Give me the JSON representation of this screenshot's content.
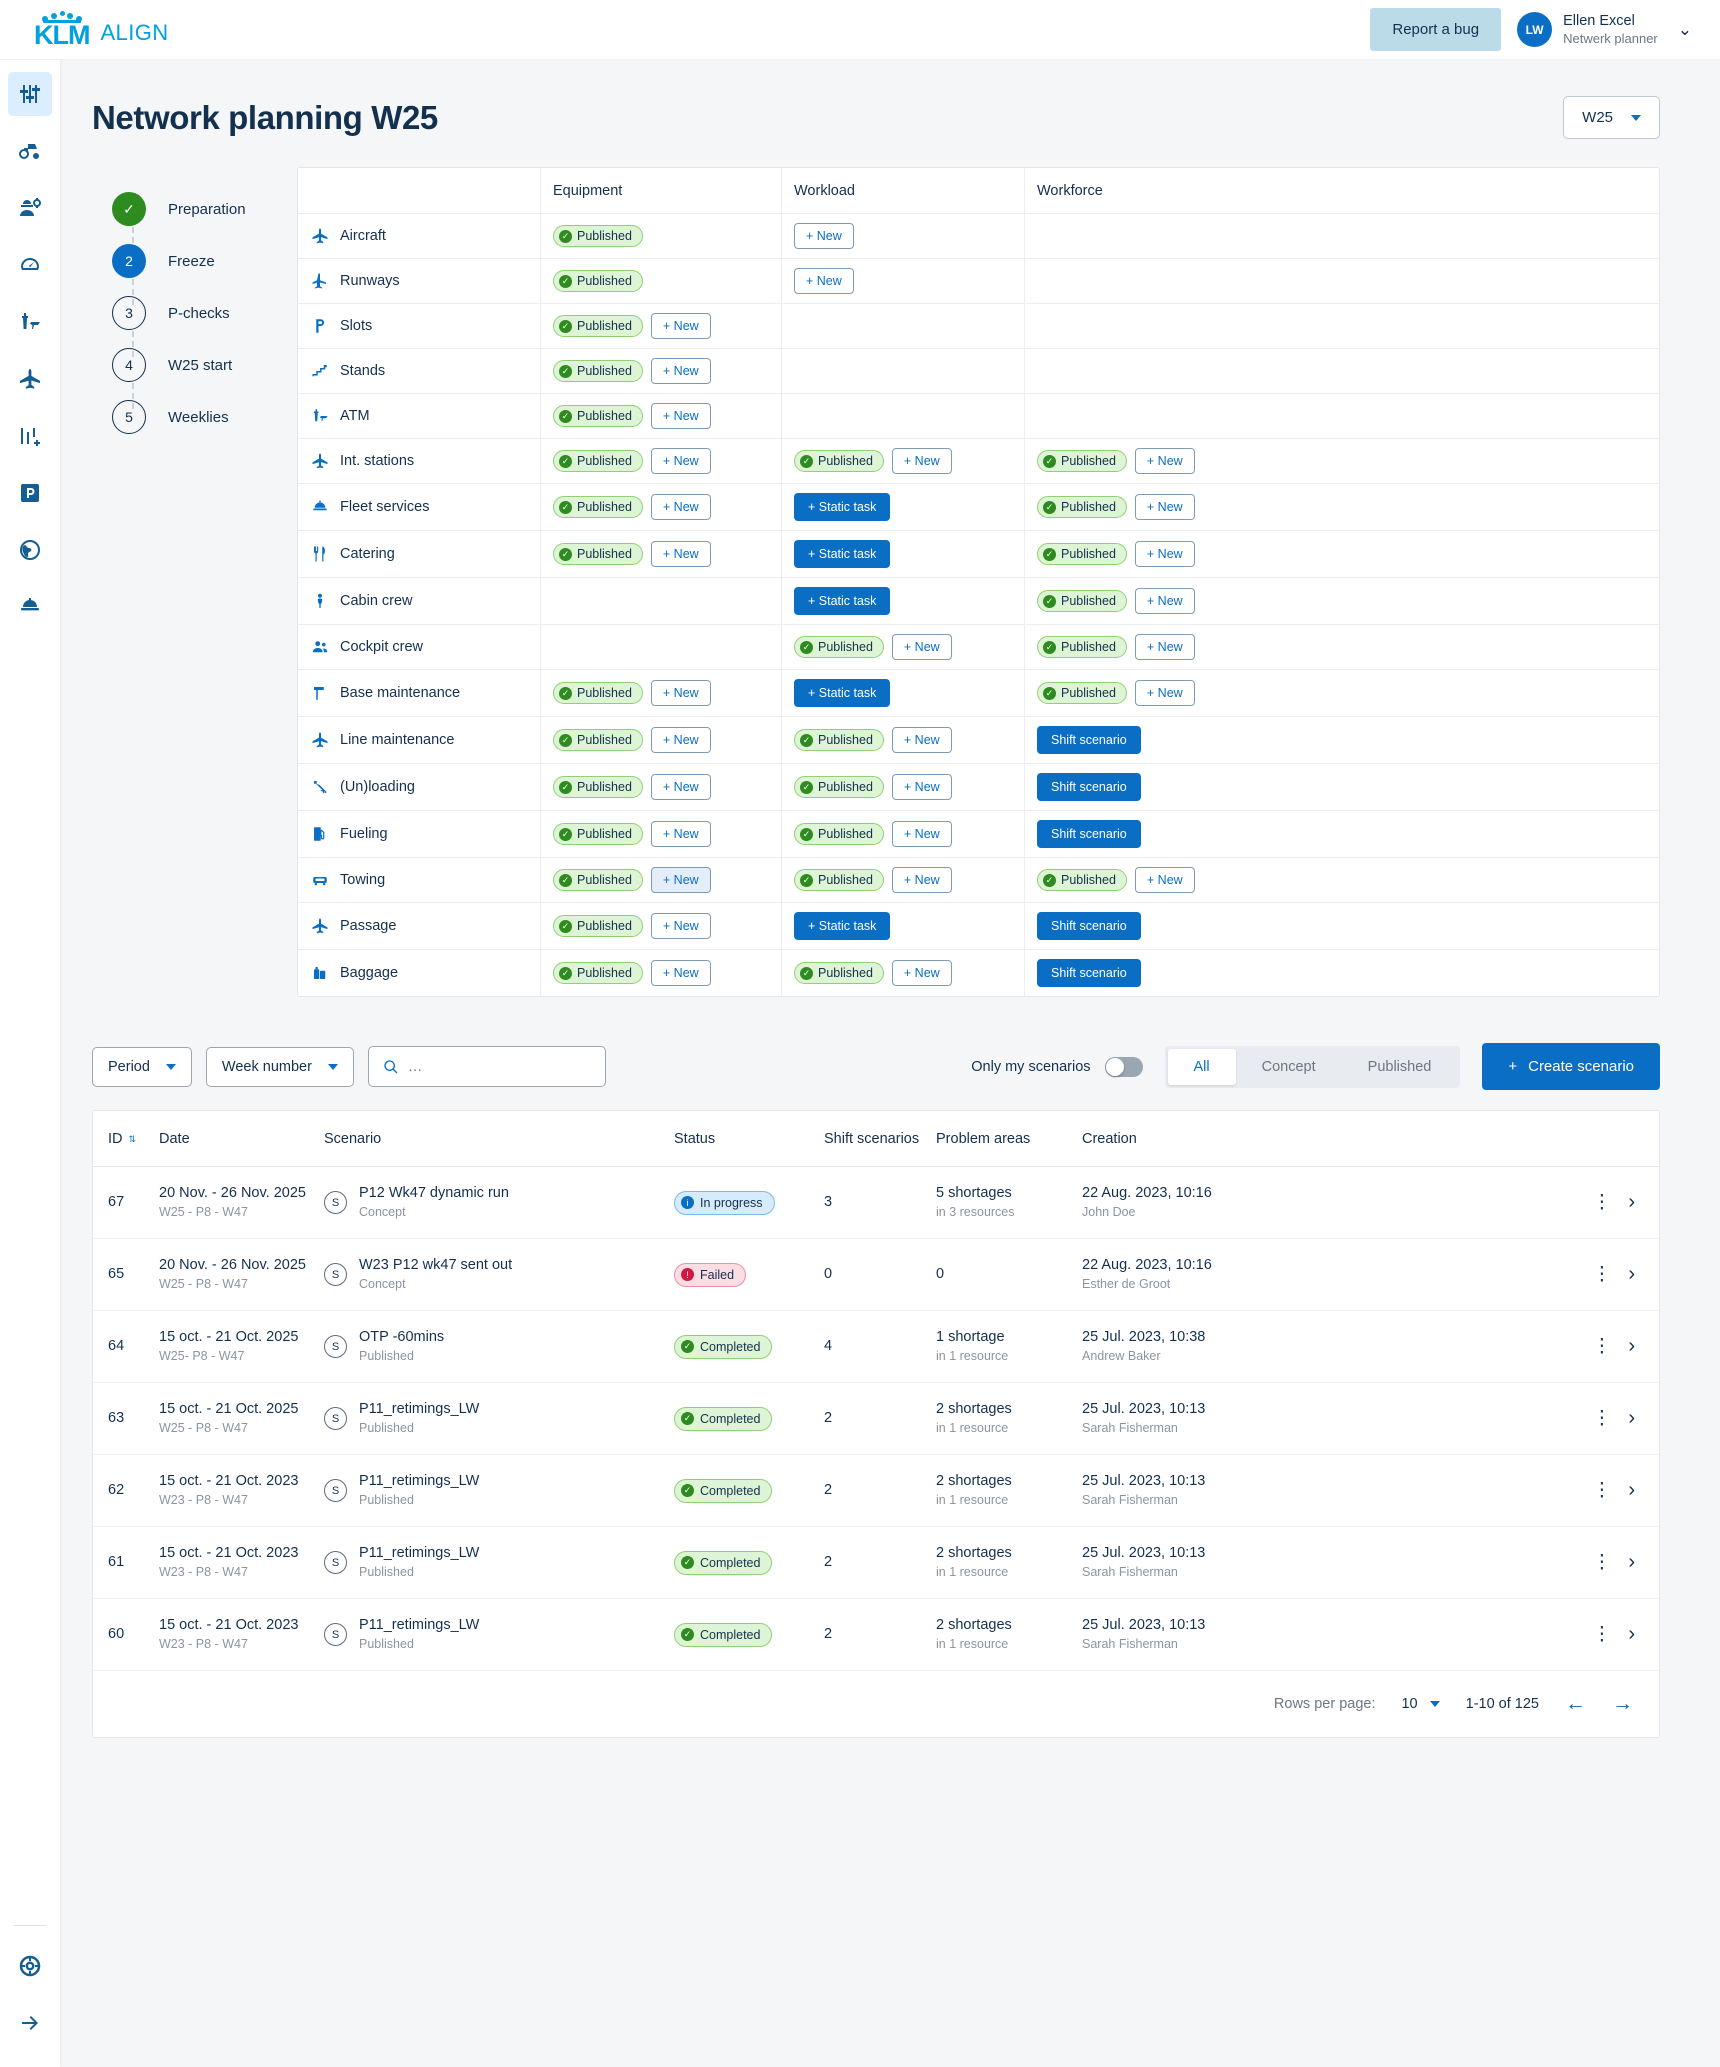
{
  "header": {
    "brand_main": "KLM",
    "brand_sub": "ALIGN",
    "report_bug": "Report a bug",
    "avatar_initials": "LW",
    "user_name": "Ellen Excel",
    "user_role": "Netwerk planner"
  },
  "sidebar": {
    "items": [
      {
        "name": "sliders-icon",
        "label": "Planning settings"
      },
      {
        "name": "tractor-icon",
        "label": "Ground equipment"
      },
      {
        "name": "engineer-icon",
        "label": "Engineering"
      },
      {
        "name": "gauge-icon",
        "label": "Performance"
      },
      {
        "name": "control-tower-icon",
        "label": "ATM"
      },
      {
        "name": "airplane-icon",
        "label": "Aircraft"
      },
      {
        "name": "chart-add-icon",
        "label": "Scenarios"
      },
      {
        "name": "parking-icon",
        "label": "Stands"
      },
      {
        "name": "globe-icon",
        "label": "Network"
      },
      {
        "name": "service-bell-icon",
        "label": "Fleet services"
      }
    ],
    "bottom": [
      {
        "name": "lifebuoy-icon",
        "label": "Help"
      },
      {
        "name": "arrow-right-icon",
        "label": "Expand menu"
      }
    ]
  },
  "page": {
    "title": "Network planning W25",
    "week_select": "W25"
  },
  "stepper": [
    {
      "marker": "✓",
      "label": "Preparation",
      "state": "done"
    },
    {
      "marker": "2",
      "label": "Freeze",
      "state": "current"
    },
    {
      "marker": "3",
      "label": "P-checks",
      "state": "todo"
    },
    {
      "marker": "4",
      "label": "W25 start",
      "state": "todo"
    },
    {
      "marker": "5",
      "label": "Weeklies",
      "state": "todo"
    }
  ],
  "status_table": {
    "columns": [
      "",
      "Equipment",
      "Workload",
      "Workforce"
    ],
    "labels": {
      "published": "Published",
      "new": "+ New",
      "static_task": "+ Static task",
      "shift_scenario": "Shift scenario"
    },
    "rows": [
      {
        "icon": "airplane-icon",
        "name": "Aircraft",
        "equipment": {
          "published": true,
          "new": false
        },
        "workload": {
          "published": false,
          "new": true
        },
        "workforce": {}
      },
      {
        "icon": "runway-icon",
        "name": "Runways",
        "equipment": {
          "published": true,
          "new": false
        },
        "workload": {
          "published": false,
          "new": true
        },
        "workforce": {}
      },
      {
        "icon": "parking-icon",
        "name": "Slots",
        "equipment": {
          "published": true,
          "new": true
        },
        "workload": {},
        "workforce": {}
      },
      {
        "icon": "stairs-icon",
        "name": "Stands",
        "equipment": {
          "published": true,
          "new": true
        },
        "workload": {},
        "workforce": {}
      },
      {
        "icon": "control-tower-icon",
        "name": "ATM",
        "equipment": {
          "published": true,
          "new": true
        },
        "workload": {},
        "workforce": {}
      },
      {
        "icon": "airplane-icon",
        "name": "Int. stations",
        "equipment": {
          "published": true,
          "new": true
        },
        "workload": {
          "published": true,
          "new": true
        },
        "workforce": {
          "published": true,
          "new": true
        }
      },
      {
        "icon": "service-bell-icon",
        "name": "Fleet services",
        "equipment": {
          "published": true,
          "new": true
        },
        "workload": {
          "static": true
        },
        "workforce": {
          "published": true,
          "new": true
        }
      },
      {
        "icon": "cutlery-icon",
        "name": "Catering",
        "equipment": {
          "published": true,
          "new": true
        },
        "workload": {
          "static": true
        },
        "workforce": {
          "published": true,
          "new": true
        }
      },
      {
        "icon": "person-icon",
        "name": "Cabin crew",
        "equipment": {},
        "workload": {
          "static": true
        },
        "workforce": {
          "published": true,
          "new": true
        }
      },
      {
        "icon": "people-icon",
        "name": "Cockpit crew",
        "equipment": {},
        "workload": {
          "published": true,
          "new": true
        },
        "workforce": {
          "published": true,
          "new": true
        }
      },
      {
        "icon": "wrench-icon",
        "name": "Base maintenance",
        "equipment": {
          "published": true,
          "new": true
        },
        "workload": {
          "static": true
        },
        "workforce": {
          "published": true,
          "new": true
        }
      },
      {
        "icon": "airplane-icon",
        "name": "Line maintenance",
        "equipment": {
          "published": true,
          "new": true
        },
        "workload": {
          "published": true,
          "new": true
        },
        "workforce": {
          "shift": true
        }
      },
      {
        "icon": "loading-icon",
        "name": "(Un)loading",
        "equipment": {
          "published": true,
          "new": true
        },
        "workload": {
          "published": true,
          "new": true
        },
        "workforce": {
          "shift": true
        }
      },
      {
        "icon": "fuel-icon",
        "name": "Fueling",
        "equipment": {
          "published": true,
          "new": true
        },
        "workload": {
          "published": true,
          "new": true
        },
        "workforce": {
          "shift": true
        }
      },
      {
        "icon": "tow-icon",
        "name": "Towing",
        "equipment": {
          "published": true,
          "new": true,
          "new_hover": true
        },
        "workload": {
          "published": true,
          "new": true
        },
        "workforce": {
          "published": true,
          "new": true
        }
      },
      {
        "icon": "airplane-icon",
        "name": "Passage",
        "equipment": {
          "published": true,
          "new": true
        },
        "workload": {
          "static": true
        },
        "workforce": {
          "shift": true
        }
      },
      {
        "icon": "baggage-icon",
        "name": "Baggage",
        "equipment": {
          "published": true,
          "new": true
        },
        "workload": {
          "published": true,
          "new": true
        },
        "workforce": {
          "shift": true
        }
      }
    ]
  },
  "filters": {
    "period": "Period",
    "week_number": "Week number",
    "search_placeholder": "…",
    "search_value": "",
    "only_my_scenarios": "Only my scenarios",
    "toggle_on": false,
    "tabs": [
      {
        "label": "All",
        "active": true
      },
      {
        "label": "Concept",
        "active": false
      },
      {
        "label": "Published",
        "active": false
      }
    ],
    "create_scenario": "Create scenario",
    "create_plus": "+"
  },
  "datatable": {
    "columns": [
      "ID",
      "Date",
      "Scenario",
      "Status",
      "Shift scenarios",
      "Problem areas",
      "Creation"
    ],
    "rows": [
      {
        "id": "67",
        "date": "20 Nov. - 26 Nov. 2025",
        "date_sub": "W25 - P8 - W47",
        "scenario": "P12 Wk47 dynamic run",
        "scenario_sub": "Concept",
        "scenario_badge": "S",
        "status": "In progress",
        "status_type": "prog",
        "shift": "3",
        "problem": "5 shortages",
        "problem_sub": "in 3 resources",
        "creation": "22 Aug. 2023, 10:16",
        "creation_sub": "John Doe"
      },
      {
        "id": "65",
        "date": "20 Nov. - 26 Nov. 2025",
        "date_sub": "W25 - P8 - W47",
        "scenario": "W23 P12 wk47 sent out",
        "scenario_sub": "Concept",
        "scenario_badge": "S",
        "status": "Failed",
        "status_type": "fail",
        "shift": "0",
        "problem": "0",
        "problem_sub": "",
        "creation": "22 Aug. 2023, 10:16",
        "creation_sub": "Esther de Groot"
      },
      {
        "id": "64",
        "date": "15 oct. - 21 Oct. 2025",
        "date_sub": "W25- P8 - W47",
        "scenario": "OTP -60mins",
        "scenario_sub": "Published",
        "scenario_badge": "S",
        "status": "Completed",
        "status_type": "comp",
        "shift": "4",
        "problem": "1 shortage",
        "problem_sub": "in 1 resource",
        "creation": "25 Jul. 2023, 10:38",
        "creation_sub": "Andrew Baker"
      },
      {
        "id": "63",
        "date": "15 oct. - 21 Oct. 2025",
        "date_sub": "W25 - P8 - W47",
        "scenario": "P11_retimings_LW",
        "scenario_sub": "Published",
        "scenario_badge": "S",
        "status": "Completed",
        "status_type": "comp",
        "shift": "2",
        "problem": "2 shortages",
        "problem_sub": "in 1 resource",
        "creation": "25 Jul. 2023, 10:13",
        "creation_sub": "Sarah Fisherman"
      },
      {
        "id": "62",
        "date": "15 oct. - 21 Oct. 2023",
        "date_sub": "W23 - P8 - W47",
        "scenario": "P11_retimings_LW",
        "scenario_sub": "Published",
        "scenario_badge": "S",
        "status": "Completed",
        "status_type": "comp",
        "shift": "2",
        "problem": "2 shortages",
        "problem_sub": "in 1 resource",
        "creation": "25 Jul. 2023, 10:13",
        "creation_sub": "Sarah Fisherman"
      },
      {
        "id": "61",
        "date": "15 oct. - 21 Oct. 2023",
        "date_sub": "W23 - P8 - W47",
        "scenario": "P11_retimings_LW",
        "scenario_sub": "Published",
        "scenario_badge": "S",
        "status": "Completed",
        "status_type": "comp",
        "shift": "2",
        "problem": "2 shortages",
        "problem_sub": "in 1 resource",
        "creation": "25 Jul. 2023, 10:13",
        "creation_sub": "Sarah Fisherman"
      },
      {
        "id": "60",
        "date": "15 oct. - 21 Oct. 2023",
        "date_sub": "W23 - P8 - W47",
        "scenario": "P11_retimings_LW",
        "scenario_sub": "Published",
        "scenario_badge": "S",
        "status": "Completed",
        "status_type": "comp",
        "shift": "2",
        "problem": "2 shortages",
        "problem_sub": "in 1 resource",
        "creation": "25 Jul. 2023, 10:13",
        "creation_sub": "Sarah Fisherman"
      }
    ],
    "footer": {
      "rows_per_page_label": "Rows per page:",
      "rows_per_page_value": "10",
      "range": "1-10 of 125"
    }
  },
  "colors": {
    "brand": "#00a1de",
    "accent": "#0a6ec4",
    "success": "#2e8b20",
    "danger": "#d41742",
    "text": "#14304f"
  }
}
